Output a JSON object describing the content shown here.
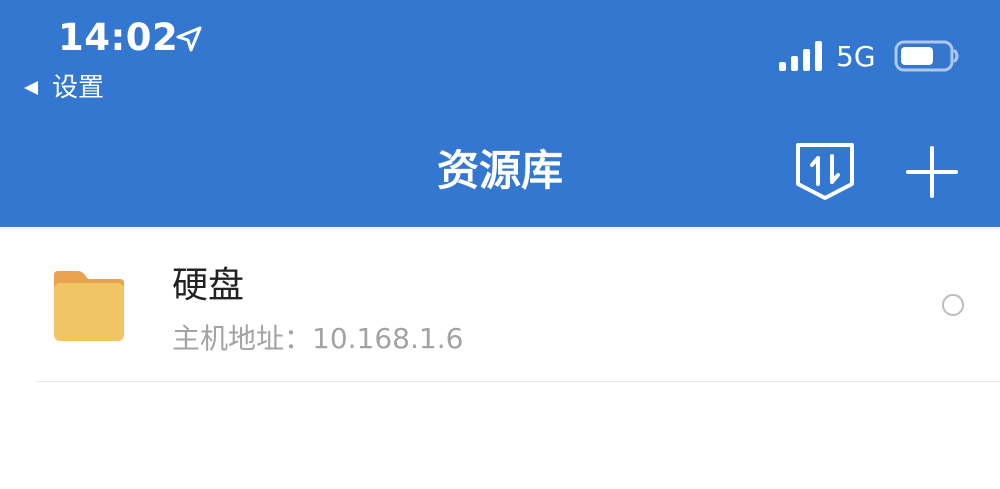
{
  "status_bar": {
    "time": "14:02",
    "network": "5G"
  },
  "back": {
    "label": "设置"
  },
  "nav": {
    "title": "资源库"
  },
  "items": [
    {
      "title": "硬盘",
      "subtitle": "主机地址：10.168.1.6",
      "icon": "folder-icon"
    }
  ],
  "colors": {
    "header": "#3377D0",
    "folder": "#F2C564",
    "folder_tab": "#E9A24F",
    "subtitle": "#A3A3A3"
  }
}
